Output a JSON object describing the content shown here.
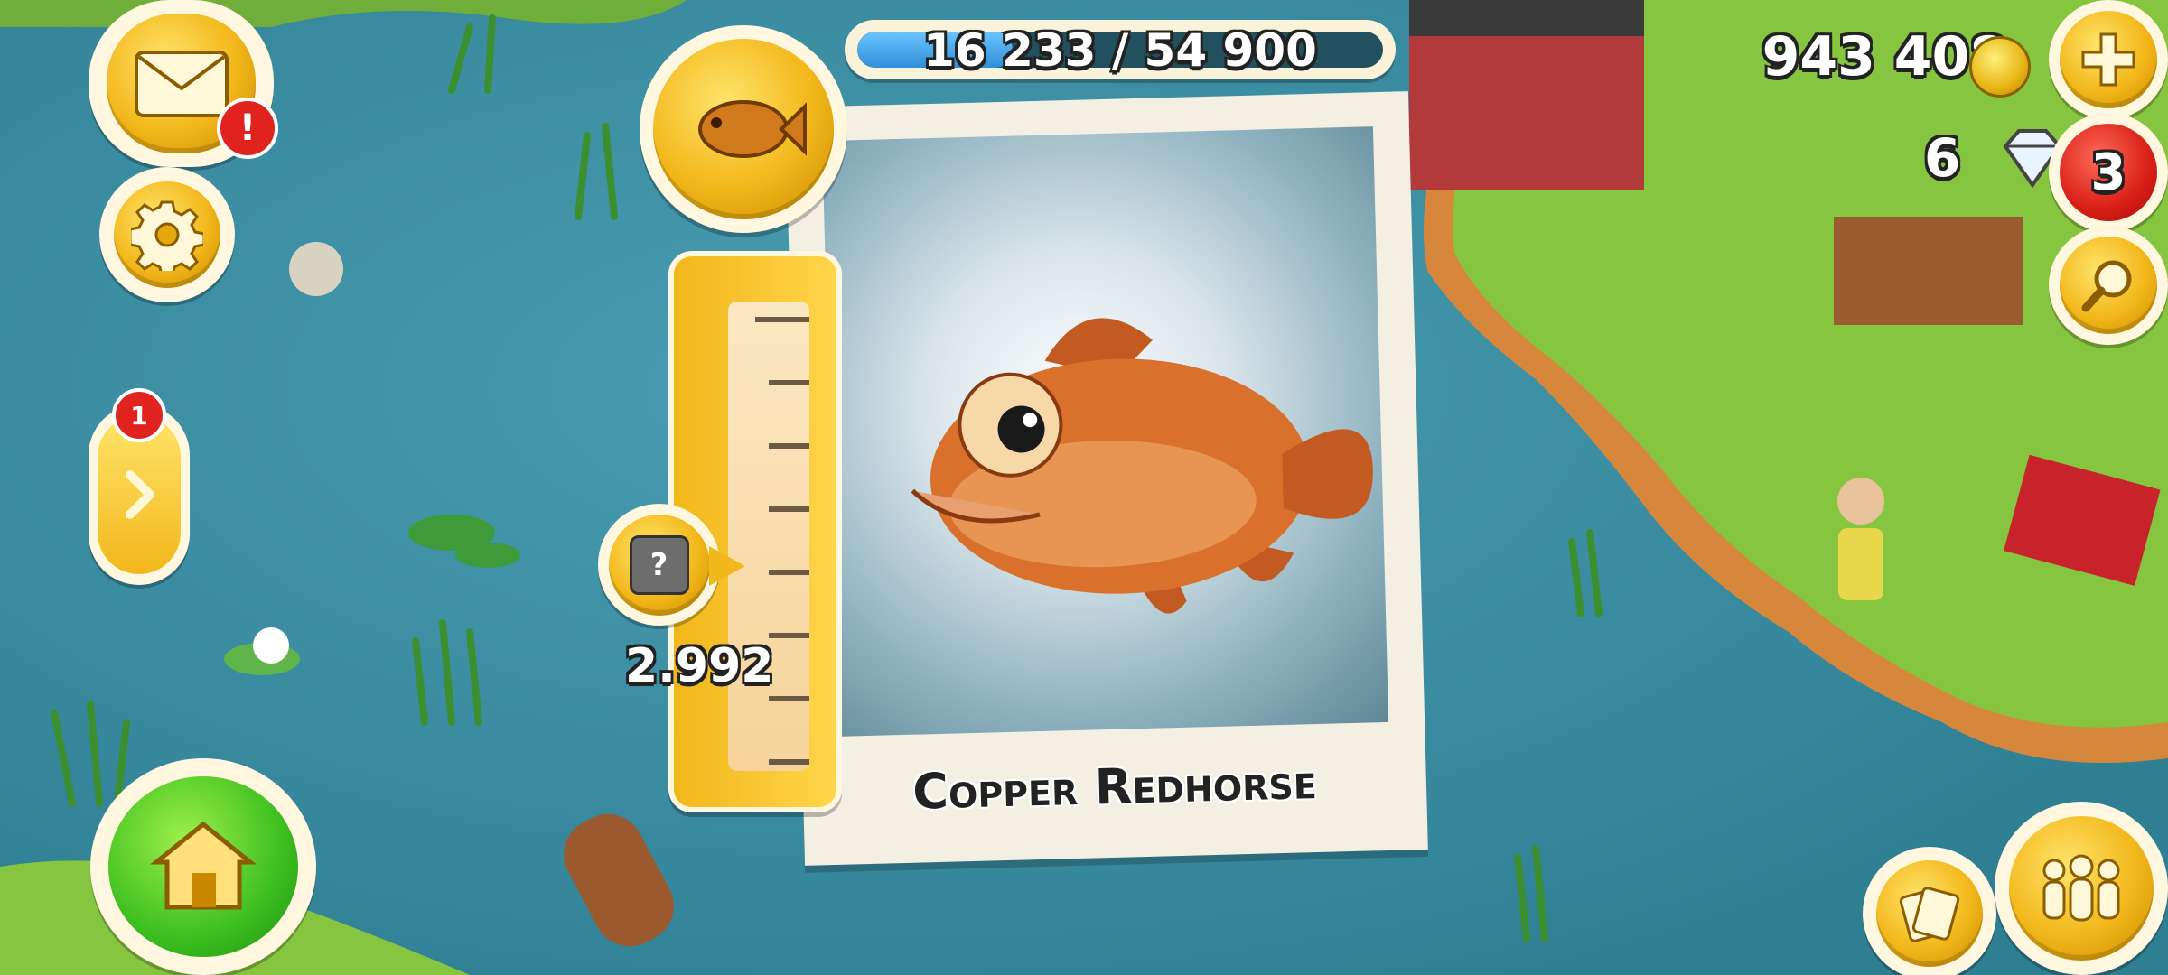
{
  "hud": {
    "xp_progress": "16 233 / 54 900",
    "xp_fraction": 0.2957,
    "coins": "943 408",
    "diamonds": "6",
    "notifications_count": "3",
    "menu_badge": "1",
    "mail_alert": "!"
  },
  "fish_card": {
    "name": "Copper Redhorse",
    "weight": "2.992",
    "weight_icon_symbol": "?"
  },
  "icons": {
    "mail": "mail-icon",
    "settings": "gear-icon",
    "expand": "chevron-right-icon",
    "home": "home-icon",
    "add": "plus-icon",
    "search": "magnifier-icon",
    "friends": "friends-icon",
    "cards": "cards-icon",
    "fish_badge": "fish-icon",
    "weight": "weight-icon"
  },
  "colors": {
    "water": "#3f8fa3",
    "grass": "#7fc43a",
    "gold": "#f2b71a",
    "alert_red": "#e0231f",
    "xp_blue": "#3da3e6"
  }
}
